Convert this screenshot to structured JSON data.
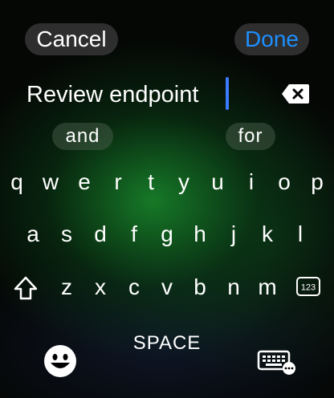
{
  "header": {
    "cancel_label": "Cancel",
    "done_label": "Done",
    "done_color": "#1e90ff"
  },
  "input": {
    "value": "Review endpoint",
    "caret_color": "#3b7bff",
    "delete_icon": "backspace-icon"
  },
  "suggestions": [
    "and",
    "for"
  ],
  "keyboard": {
    "row1": [
      "q",
      "w",
      "e",
      "r",
      "t",
      "y",
      "u",
      "i",
      "o",
      "p"
    ],
    "row2": [
      "a",
      "s",
      "d",
      "f",
      "g",
      "h",
      "j",
      "k",
      "l"
    ],
    "row3": [
      "z",
      "x",
      "c",
      "v",
      "b",
      "n",
      "m"
    ],
    "shift_icon": "shift-icon",
    "numbers_label": "123",
    "space_label": "SPACE",
    "emoji_icon": "emoji-icon",
    "keyboard_options_icon": "keyboard-options-icon"
  }
}
